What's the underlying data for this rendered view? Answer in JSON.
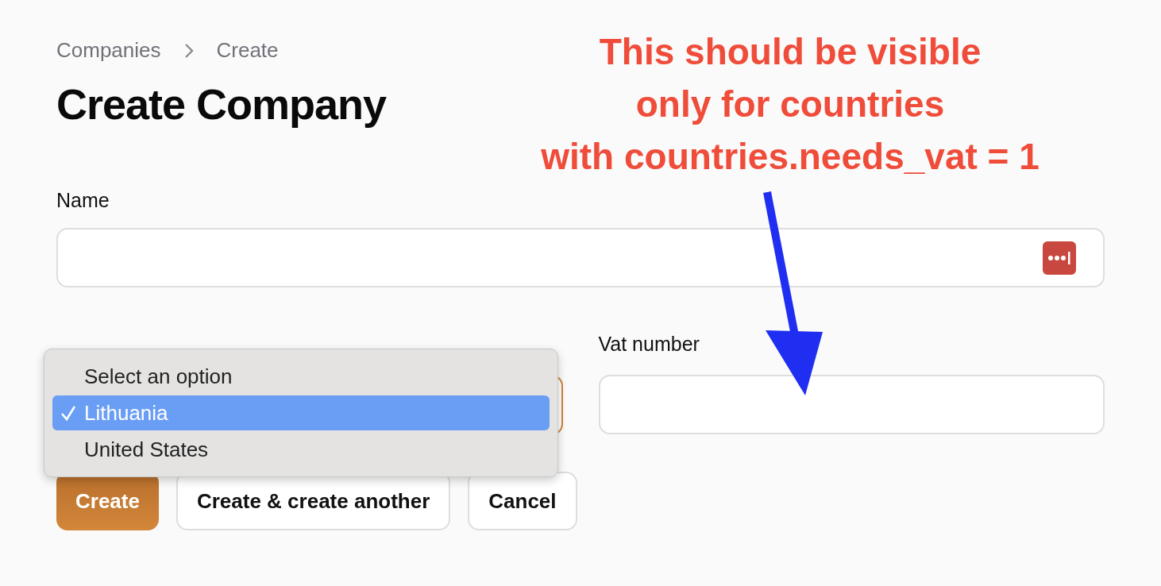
{
  "breadcrumb": [
    "Companies",
    "Create"
  ],
  "title": "Create Company",
  "annotation": {
    "lines": [
      "This should be visible",
      "only for countries",
      "with countries.needs_vat = 1"
    ]
  },
  "fields": {
    "name": {
      "label": "Name"
    },
    "country": {
      "focused": true
    },
    "vat": {
      "label": "Vat number"
    }
  },
  "dropdown": {
    "options": [
      {
        "label": "Select an option",
        "selected": false
      },
      {
        "label": "Lithuania",
        "selected": true
      },
      {
        "label": "United States",
        "selected": false
      }
    ]
  },
  "buttons": [
    {
      "label": "Create",
      "kind": "primary"
    },
    {
      "label": "Create & create another",
      "kind": "secondary"
    },
    {
      "label": "Cancel",
      "kind": "secondary"
    }
  ]
}
